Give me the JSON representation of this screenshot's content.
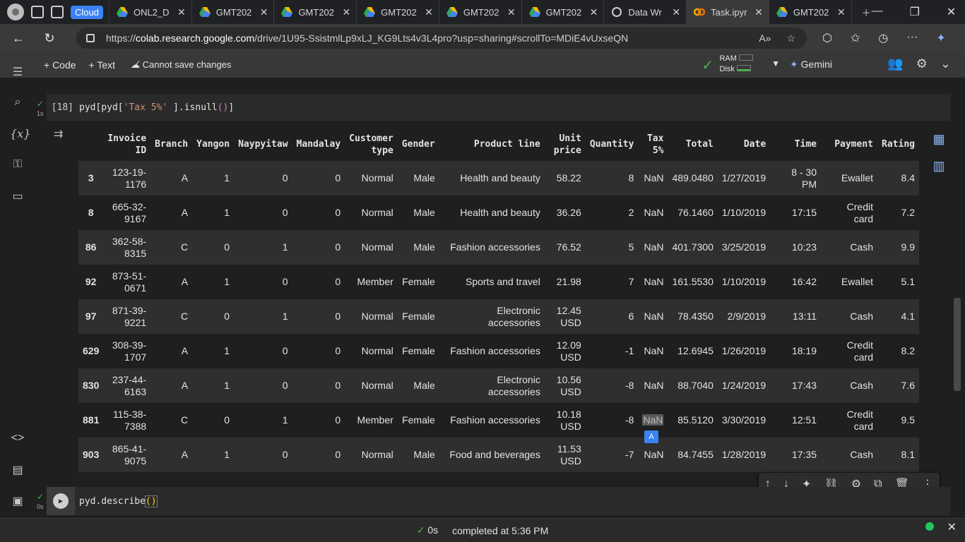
{
  "browser": {
    "tabs": [
      {
        "label": "Cloud",
        "kind": "badge"
      },
      {
        "label": "ONL2_D",
        "kind": "drive"
      },
      {
        "label": "GMT202",
        "kind": "drive"
      },
      {
        "label": "GMT202",
        "kind": "drive"
      },
      {
        "label": "GMT202",
        "kind": "drive"
      },
      {
        "label": "GMT202",
        "kind": "drive"
      },
      {
        "label": "GMT202",
        "kind": "drive"
      },
      {
        "label": "Data Wr",
        "kind": "web"
      },
      {
        "label": "Task.ipyr",
        "kind": "colab",
        "active": true
      },
      {
        "label": "GMT202",
        "kind": "drive"
      }
    ],
    "url_scheme": "https://",
    "url_host": "colab.research.google.com",
    "url_path": "/drive/1U95-SsistmlLp9xLJ_KG9Lts4v3L4pro?usp=sharing#scrollTo=MDiE4vUxseQN"
  },
  "colab": {
    "code_btn": "+ Code",
    "text_btn": "+ Text",
    "warning": "Cannot save changes",
    "ram_label": "RAM",
    "disk_label": "Disk",
    "gemini_label": "Gemini"
  },
  "cell1": {
    "exec_count": "[18]",
    "duration": "1s",
    "code_prefix": "pyd[pyd[",
    "code_string": "'Tax 5%'",
    "code_suffix": " ].isnull",
    "code_paren": "()",
    "code_close": "]"
  },
  "table": {
    "columns": [
      "",
      "Invoice ID",
      "Branch",
      "Yangon",
      "Naypyitaw",
      "Mandalay",
      "Customer type",
      "Gender",
      "Product line",
      "Unit price",
      "Quantity",
      "Tax 5%",
      "Total",
      "Date",
      "Time",
      "Payment",
      "Rating"
    ],
    "rows": [
      [
        "3",
        "123-19-1176",
        "A",
        "1",
        "0",
        "0",
        "Normal",
        "Male",
        "Health and beauty",
        "58.22",
        "8",
        "NaN",
        "489.0480",
        "1/27/2019",
        "8 - 30 PM",
        "Ewallet",
        "8.4"
      ],
      [
        "8",
        "665-32-9167",
        "A",
        "1",
        "0",
        "0",
        "Normal",
        "Male",
        "Health and beauty",
        "36.26",
        "2",
        "NaN",
        "76.1460",
        "1/10/2019",
        "17:15",
        "Credit card",
        "7.2"
      ],
      [
        "86",
        "362-58-8315",
        "C",
        "0",
        "1",
        "0",
        "Normal",
        "Male",
        "Fashion accessories",
        "76.52",
        "5",
        "NaN",
        "401.7300",
        "3/25/2019",
        "10:23",
        "Cash",
        "9.9"
      ],
      [
        "92",
        "873-51-0671",
        "A",
        "1",
        "0",
        "0",
        "Member",
        "Female",
        "Sports and travel",
        "21.98",
        "7",
        "NaN",
        "161.5530",
        "1/10/2019",
        "16:42",
        "Ewallet",
        "5.1"
      ],
      [
        "97",
        "871-39-9221",
        "C",
        "0",
        "1",
        "0",
        "Normal",
        "Female",
        "Electronic accessories",
        "12.45 USD",
        "6",
        "NaN",
        "78.4350",
        "2/9/2019",
        "13:11",
        "Cash",
        "4.1"
      ],
      [
        "629",
        "308-39-1707",
        "A",
        "1",
        "0",
        "0",
        "Normal",
        "Female",
        "Fashion accessories",
        "12.09 USD",
        "-1",
        "NaN",
        "12.6945",
        "1/26/2019",
        "18:19",
        "Credit card",
        "8.2"
      ],
      [
        "830",
        "237-44-6163",
        "A",
        "1",
        "0",
        "0",
        "Normal",
        "Male",
        "Electronic accessories",
        "10.56 USD",
        "-8",
        "NaN",
        "88.7040",
        "1/24/2019",
        "17:43",
        "Cash",
        "7.6"
      ],
      [
        "881",
        "115-38-7388",
        "C",
        "0",
        "1",
        "0",
        "Member",
        "Female",
        "Fashion accessories",
        "10.18 USD",
        "-8",
        "NaN",
        "85.5120",
        "3/30/2019",
        "12:51",
        "Credit card",
        "9.5"
      ],
      [
        "903",
        "865-41-9075",
        "A",
        "1",
        "0",
        "0",
        "Normal",
        "Male",
        "Food and beverages",
        "11.53 USD",
        "-7",
        "NaN",
        "84.7455",
        "1/28/2019",
        "17:35",
        "Cash",
        "8.1"
      ]
    ]
  },
  "cell2": {
    "duration": "0s",
    "code": "pyd.describe",
    "code_paren": "()"
  },
  "status": {
    "elapsed": "0s",
    "message": "completed at 5:36 PM"
  }
}
